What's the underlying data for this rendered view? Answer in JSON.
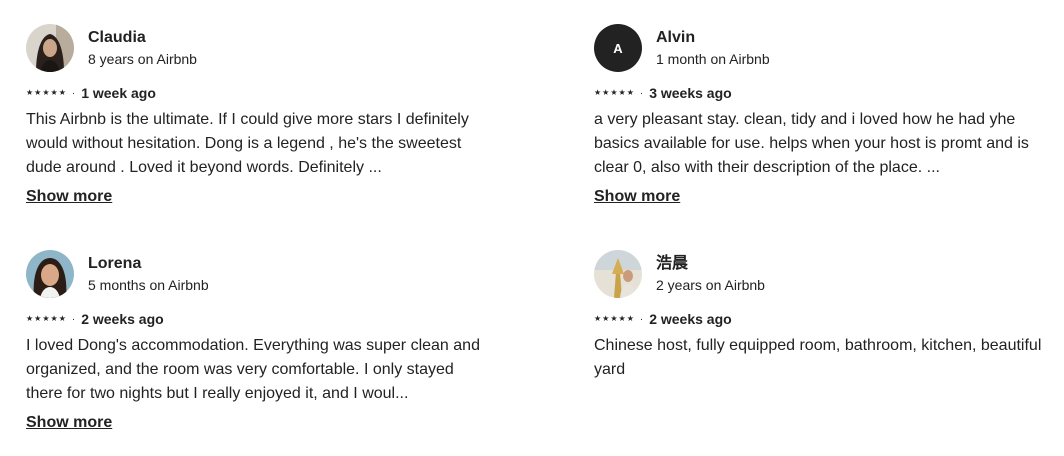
{
  "reviews": [
    {
      "name": "Claudia",
      "tenure": "8 years on Airbnb",
      "stars": 5,
      "when": "1 week ago",
      "text": "This Airbnb is the ultimate. If I could give more stars I definitely would without hesitation. Dong is a legend , he's the sweetest dude around . Loved it beyond words. Definitely ...",
      "show_more": "Show more"
    },
    {
      "name": "Alvin",
      "tenure": "1 month on Airbnb",
      "avatar_letter": "A",
      "stars": 5,
      "when": "3 weeks ago",
      "text": "a very pleasant stay. clean, tidy and i loved how he had yhe basics available for use. helps when your host is promt and is clear 0, also with their description of the place. ...",
      "show_more": "Show more"
    },
    {
      "name": "Lorena",
      "tenure": "5 months on Airbnb",
      "stars": 5,
      "when": "2 weeks ago",
      "text": "I loved Dong's accommodation. Everything was super clean and organized, and the room was very comfortable. I only stayed there for two nights but I really enjoyed it, and I woul...",
      "show_more": "Show more"
    },
    {
      "name": "浩晨",
      "tenure": "2 years on Airbnb",
      "stars": 5,
      "when": "2 weeks ago",
      "text": "Chinese host, fully equipped room, bathroom, kitchen, beautiful yard"
    }
  ],
  "separator": "·",
  "star_glyph": "★",
  "star_color": "#222222"
}
